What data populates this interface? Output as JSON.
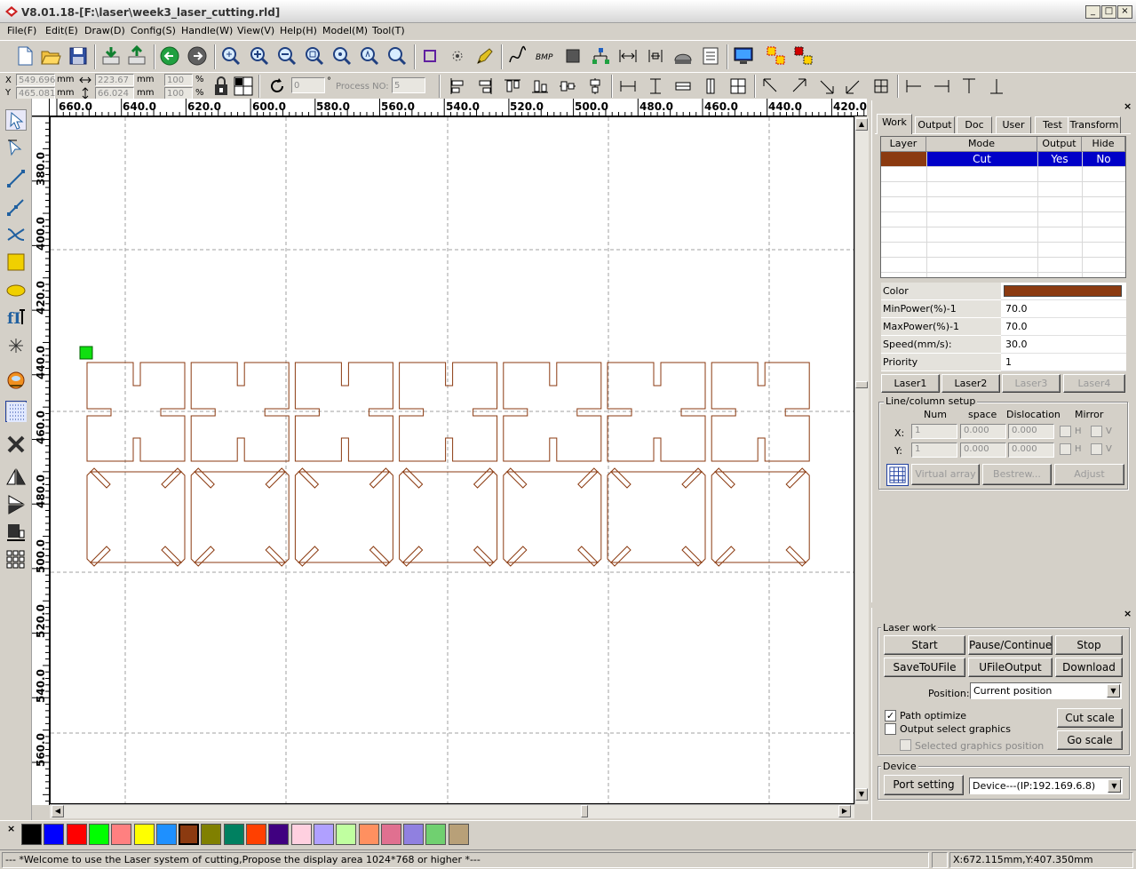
{
  "window": {
    "title": "V8.01.18-[F:\\laser\\week3_laser_cutting.rld]",
    "minimize": "_",
    "maximize": "□",
    "close": "×"
  },
  "menu": [
    "File(F)",
    "Edit(E)",
    "Draw(D)",
    "Config(S)",
    "Handle(W)",
    "View(V)",
    "Help(H)",
    "Model(M)",
    "Tool(T)"
  ],
  "toolbar1_icons": [
    "new-file-icon",
    "open-folder-icon",
    "save-icon",
    "import-icon",
    "export-icon",
    "undo-icon",
    "redo-icon",
    "zoom-fit-icon",
    "zoom-in-icon",
    "zoom-out-icon",
    "zoom-page-icon",
    "zoom-select-icon",
    "zoom-data-icon",
    "zoom-window-icon",
    "select-rect-icon",
    "node-edit-icon",
    "pen-icon",
    "curve-smooth-icon",
    "bmp-icon",
    "fill-icon",
    "tree-icon",
    "distance-icon",
    "width-icon",
    "laser-head-icon",
    "list-icon",
    "monitor-icon",
    "array-icon",
    "layer-color-icon"
  ],
  "toolbar2": {
    "x_label": "X",
    "y_label": "Y",
    "x_value": "549.696",
    "y_value": "465.081",
    "unit1": "mm",
    "unit2": "mm",
    "w_value": "223.67",
    "h_value": "66.024",
    "unit3": "mm",
    "unit4": "mm",
    "pct_w": "100",
    "pct_h": "100",
    "pct_sym1": "%",
    "pct_sym2": "%",
    "angle_value": "0",
    "angle_unit": "°",
    "process_label": "Process NO:",
    "process_value": "5"
  },
  "left_tools": [
    "pointer-icon",
    "node-select-icon",
    "line-icon",
    "polyline-icon",
    "curve-icon",
    "rectangle-icon",
    "ellipse-icon",
    "text-icon",
    "point-icon",
    "laser-head-icon",
    "grid-icon",
    "delete-icon",
    "mirror-h-icon",
    "mirror-v-icon",
    "rotate-icon",
    "array-icon"
  ],
  "ruler": {
    "h_labels": [
      "660.0",
      "640.0",
      "620.0",
      "600.0",
      "580.0",
      "560.0",
      "540.0",
      "520.0",
      "500.0",
      "480.0",
      "460.0",
      "440.0",
      "420.0"
    ],
    "v_labels": [
      "380.0",
      "400.0",
      "420.0",
      "440.0",
      "460.0",
      "480.0",
      "500.0",
      "520.0",
      "540.0",
      "560.0"
    ]
  },
  "work_panel": {
    "tabs": [
      "Work",
      "Output",
      "Doc",
      "User",
      "Test",
      "Transform"
    ],
    "active_tab": "Work",
    "table_headers": [
      "Layer",
      "Mode",
      "Output",
      "Hide"
    ],
    "rows": [
      {
        "layer_color": "#8b3a10",
        "mode": "Cut",
        "output": "Yes",
        "hide": "No"
      }
    ],
    "props": [
      {
        "label": "Color",
        "value": ""
      },
      {
        "label": "MinPower(%)-1",
        "value": "70.0"
      },
      {
        "label": "MaxPower(%)-1",
        "value": "70.0"
      },
      {
        "label": "Speed(mm/s):",
        "value": "30.0"
      },
      {
        "label": "Priority",
        "value": "1"
      }
    ],
    "color_value": "#8b3a10",
    "laser_buttons": [
      "Laser1",
      "Laser2",
      "Laser3",
      "Laser4"
    ],
    "line_column": {
      "title": "Line/column setup",
      "headers": [
        "Num",
        "space",
        "Dislocation",
        "Mirror"
      ],
      "x_label": "X:",
      "y_label": "Y:",
      "x_num": "1",
      "x_space": "0.000",
      "x_disl": "0.000",
      "y_num": "1",
      "y_space": "0.000",
      "y_disl": "0.000",
      "h": "H",
      "v": "V"
    },
    "virtual_array": "Virtual array",
    "bestrew": "Bestrew...",
    "adjust": "Adjust"
  },
  "laser_work": {
    "title": "Laser work",
    "start": "Start",
    "pause": "Pause/Continue",
    "stop": "Stop",
    "save_to_ufile": "SaveToUFile",
    "ufile_output": "UFileOutput",
    "download": "Download",
    "position_label": "Position:",
    "position_value": "Current position",
    "path_optimize": "Path optimize",
    "path_optimize_checked": true,
    "output_select": "Output select graphics",
    "selected_pos": "Selected graphics position",
    "cut_scale": "Cut scale",
    "go_scale": "Go scale",
    "device_title": "Device",
    "port_setting": "Port setting",
    "device_value": "Device---(IP:192.169.6.8)"
  },
  "palette": [
    "#000000",
    "#0000ff",
    "#ff0000",
    "#00ff00",
    "#ff8080",
    "#ffff00",
    "#1e90ff",
    "#8b3a10",
    "#808000",
    "#008060",
    "#ff4000",
    "#400080",
    "#ffd0e0",
    "#b0a0ff",
    "#c0ffa0",
    "#ff9060",
    "#e07090",
    "#9080e0",
    "#70d070",
    "#b8a078"
  ],
  "palette_selected": 7,
  "status": {
    "message": "--- *Welcome to use the Laser system of cutting,Propose the display area 1024*768 or higher *---",
    "coords": "X:672.115mm,Y:407.350mm"
  },
  "closers": {
    "x": "×"
  }
}
